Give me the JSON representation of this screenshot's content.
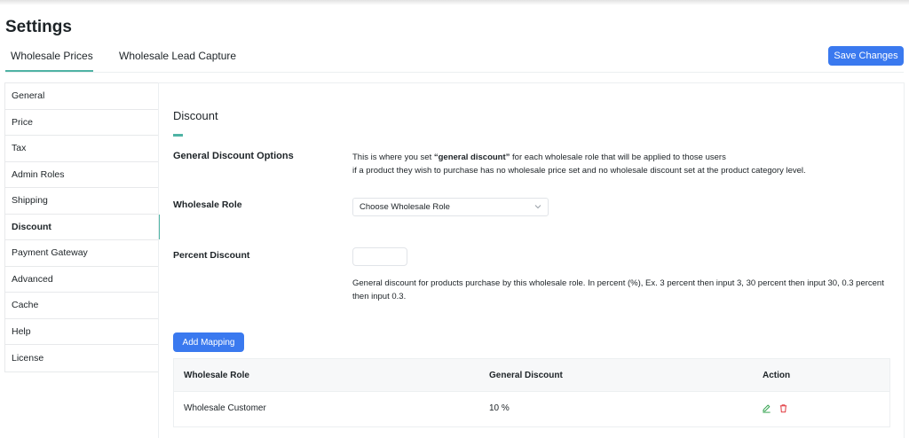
{
  "page": {
    "title": "Settings"
  },
  "tabs": [
    {
      "label": "Wholesale Prices",
      "active": true
    },
    {
      "label": "Wholesale Lead Capture",
      "active": false
    }
  ],
  "toolbar": {
    "save_label": "Save Changes"
  },
  "sidebar": {
    "items": [
      {
        "label": "General"
      },
      {
        "label": "Price"
      },
      {
        "label": "Tax"
      },
      {
        "label": "Admin Roles"
      },
      {
        "label": "Shipping"
      },
      {
        "label": "Discount",
        "active": true
      },
      {
        "label": "Payment Gateway"
      },
      {
        "label": "Advanced"
      },
      {
        "label": "Cache"
      },
      {
        "label": "Help"
      },
      {
        "label": "License"
      }
    ]
  },
  "discount": {
    "title": "Discount",
    "options_label": "General Discount Options",
    "desc_prefix": "This is where you set ",
    "desc_bold": "“general discount”",
    "desc_suffix": " for each wholesale role that will be applied to those users",
    "desc_line2": "if a product they wish to purchase has no wholesale price set and no wholesale discount set at the product category level.",
    "role_label": "Wholesale Role",
    "role_select_value": "Choose Wholesale Role",
    "percent_label": "Percent Discount",
    "percent_value": "",
    "percent_help": "General discount for products purchase by this wholesale role. In percent (%), Ex. 3 percent then input 3, 30 percent then input 30, 0.3 percent then input 0.3.",
    "add_mapping_label": "Add Mapping"
  },
  "table": {
    "headers": [
      "Wholesale Role",
      "General Discount",
      "Action"
    ],
    "rows": [
      {
        "role": "Wholesale Customer",
        "discount": "10 %"
      }
    ]
  },
  "colors": {
    "primary": "#3a79ef",
    "accent": "#4fb3a4",
    "edit_icon": "#3aa655",
    "delete_icon": "#e0393e"
  },
  "icons": {
    "select_chevron": "chevron-down-icon",
    "edit": "pencil-icon",
    "delete": "trash-icon"
  }
}
